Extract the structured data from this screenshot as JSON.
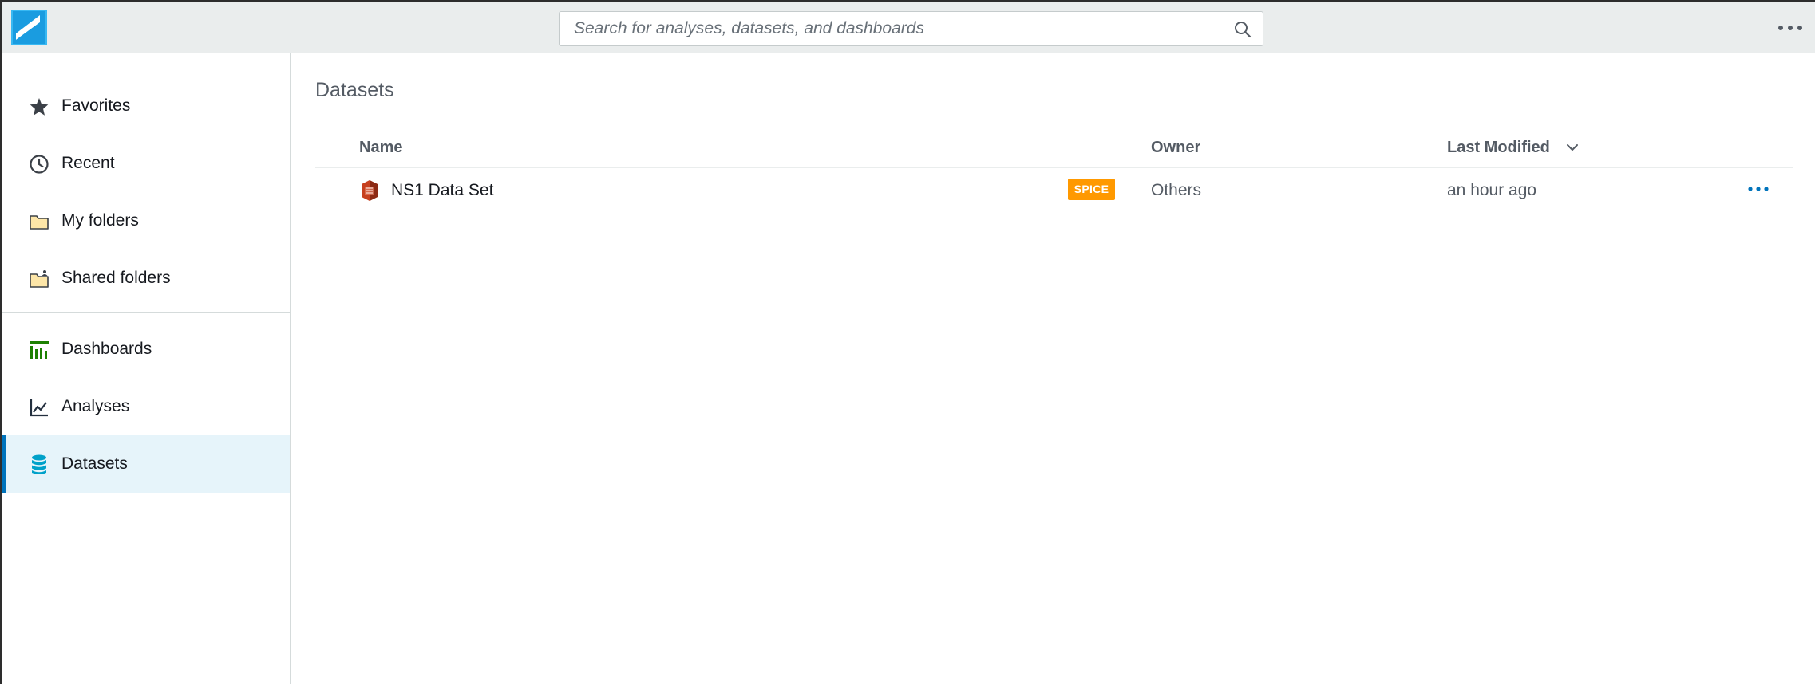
{
  "header": {
    "search": {
      "placeholder": "Search for analyses, datasets, and dashboards",
      "value": ""
    },
    "icons": {
      "logo": "quicksight-logo",
      "search": "search-icon",
      "more": "more-horizontal-icon"
    }
  },
  "sidebar": {
    "items": [
      {
        "label": "Favorites",
        "icon": "star-icon",
        "active": false
      },
      {
        "label": "Recent",
        "icon": "clock-icon",
        "active": false
      },
      {
        "label": "My folders",
        "icon": "folder-icon",
        "active": false
      },
      {
        "label": "Shared folders",
        "icon": "shared-folder-icon",
        "active": false
      },
      {
        "label": "Dashboards",
        "icon": "dashboard-icon",
        "active": false
      },
      {
        "label": "Analyses",
        "icon": "line-chart-icon",
        "active": false
      },
      {
        "label": "Datasets",
        "icon": "database-icon",
        "active": true
      }
    ]
  },
  "main": {
    "title": "Datasets",
    "table": {
      "columns": [
        "Name",
        "Owner",
        "Last Modified"
      ],
      "sort_column": "Last Modified",
      "sort_direction": "descending",
      "rows": [
        {
          "name": "NS1 Data Set",
          "badge": "SPICE",
          "owner": "Others",
          "last_modified": "an hour ago"
        }
      ]
    }
  },
  "colors": {
    "topbar": "#eaeded",
    "accent": "#0073bb",
    "active_bg": "#e6f4fa",
    "badge": "#ff9900",
    "dashboards_icon": "#1d8102",
    "datasets_icon": "#00a1c9",
    "dataset_icon": "#c7401f"
  }
}
